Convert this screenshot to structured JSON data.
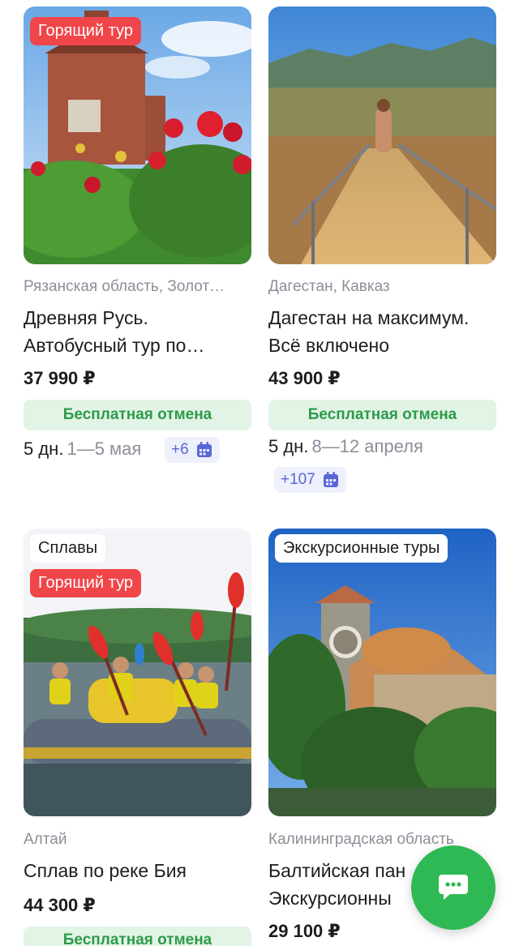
{
  "tours": [
    {
      "badge": "Горящий тур",
      "region": "Рязанская область, Золот…",
      "title_line1": "Древняя Русь.",
      "title_line2": "Автобусный тур по…",
      "price": "37 990 ₽",
      "cancel": "Бесплатная отмена",
      "duration": "5 дн.",
      "dates": "1—5 мая",
      "more_dates": "+6"
    },
    {
      "region": "Дагестан, Кавказ",
      "title_line1": "Дагестан на максимум.",
      "title_line2": "Всё включено",
      "price": "43 900 ₽",
      "cancel": "Бесплатная отмена",
      "duration": "5 дн.",
      "dates": "8—12 апреля",
      "more_dates": "+107"
    },
    {
      "category": "Сплавы",
      "badge": "Горящий тур",
      "region": "Алтай",
      "title_line1": "Сплав по реке Бия",
      "price": "44 300 ₽",
      "cancel": "Бесплатная отмена"
    },
    {
      "category": "Экскурсионные туры",
      "region": "Калининградская область",
      "title_line1": "Балтийская пан",
      "title_line2": "Экскурсионны",
      "price": "29 100 ₽"
    }
  ],
  "chat_button": {
    "icon": "chat-bubble-icon"
  },
  "colors": {
    "hot_badge": "#f0464a",
    "cancel_bg": "#e2f4e6",
    "cancel_text": "#2c9b48",
    "more_dates_text": "#5966d6",
    "chat_button": "#2fb954"
  }
}
